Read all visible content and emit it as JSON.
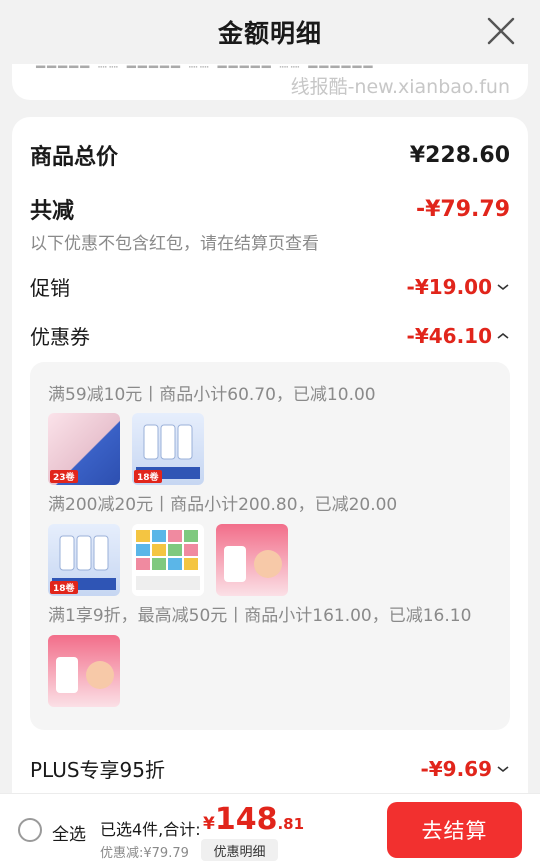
{
  "header": {
    "title": "金额明细"
  },
  "watermark": "线报酷-new.xianbao.fun",
  "summary": {
    "total_label": "商品总价",
    "total_value": "¥228.60",
    "reduction_label": "共减",
    "reduction_value": "-¥79.79",
    "reduction_note": "以下优惠不包含红包，请在结算页查看"
  },
  "promo": {
    "label": "促销",
    "value": "-¥19.00"
  },
  "coupon": {
    "label": "优惠券",
    "value": "-¥46.10",
    "groups": [
      {
        "text": "满59减10元丨商品小计60.70，已减10.00",
        "items": [
          {
            "name": "tissue-product",
            "qty": "23卷"
          },
          {
            "name": "toilet-roll-product",
            "qty": "18卷"
          }
        ]
      },
      {
        "text": "满200减20元丨商品小计200.80，已减20.00",
        "items": [
          {
            "name": "toilet-roll-product",
            "qty": "18卷"
          },
          {
            "name": "snack-pack-product",
            "qty": ""
          },
          {
            "name": "nutrition-powder-product",
            "qty": ""
          }
        ]
      },
      {
        "text": "满1享9折，最高减50元丨商品小计161.00，已减16.10",
        "items": [
          {
            "name": "nutrition-powder-product",
            "qty": ""
          }
        ]
      }
    ]
  },
  "plus": {
    "label": "PLUS专享95折",
    "value": "-¥9.69"
  },
  "bottom": {
    "select_all": "全选",
    "selected_count": "已选4件,合计:",
    "price_currency": "¥",
    "price_int": "148",
    "price_dec": ".81",
    "discount_text": "优惠减:¥79.79",
    "detail_button": "优惠明细",
    "checkout_button": "去结算"
  },
  "colors": {
    "accent": "#e1251b",
    "checkout": "#f2302f"
  }
}
